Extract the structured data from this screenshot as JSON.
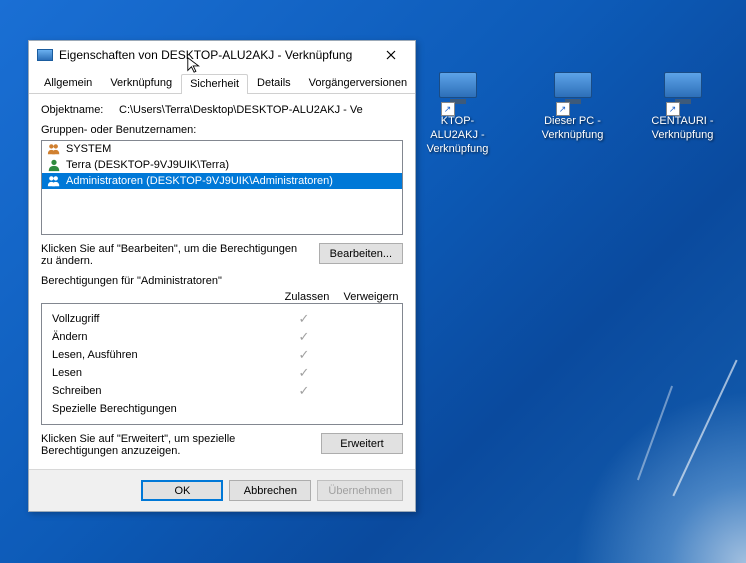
{
  "desktop_icons": [
    {
      "label_l1": "KTOP-ALU2AKJ -",
      "label_l2": "Verknüpfung"
    },
    {
      "label_l1": "Dieser PC -",
      "label_l2": "Verknüpfung"
    },
    {
      "label_l1": "CENTAURI -",
      "label_l2": "Verknüpfung"
    }
  ],
  "dialog": {
    "title": "Eigenschaften von DESKTOP-ALU2AKJ - Verknüpfung",
    "tabs": {
      "general": "Allgemein",
      "shortcut": "Verknüpfung",
      "security": "Sicherheit",
      "details": "Details",
      "previous": "Vorgängerversionen"
    },
    "objectname_label": "Objektname:",
    "objectname_value": "C:\\Users\\Terra\\Desktop\\DESKTOP-ALU2AKJ - Ve",
    "groups_label": "Gruppen- oder Benutzernamen:",
    "users": [
      {
        "name": "SYSTEM",
        "type": "group"
      },
      {
        "name": "Terra (DESKTOP-9VJ9UIK\\Terra)",
        "type": "user"
      },
      {
        "name": "Administratoren (DESKTOP-9VJ9UIK\\Administratoren)",
        "type": "group",
        "selected": true
      }
    ],
    "edit_hint": "Klicken Sie auf \"Bearbeiten\", um die Berechtigungen zu ändern.",
    "edit_btn": "Bearbeiten...",
    "perms_for": "Berechtigungen für \"Administratoren\"",
    "allow": "Zulassen",
    "deny": "Verweigern",
    "perms": [
      {
        "name": "Vollzugriff",
        "allow": true,
        "deny": false
      },
      {
        "name": "Ändern",
        "allow": true,
        "deny": false
      },
      {
        "name": "Lesen, Ausführen",
        "allow": true,
        "deny": false
      },
      {
        "name": "Lesen",
        "allow": true,
        "deny": false
      },
      {
        "name": "Schreiben",
        "allow": true,
        "deny": false
      },
      {
        "name": "Spezielle Berechtigungen",
        "allow": false,
        "deny": false
      }
    ],
    "advanced_hint": "Klicken Sie auf \"Erweitert\", um spezielle Berechtigungen anzuzeigen.",
    "advanced_btn": "Erweitert",
    "ok": "OK",
    "cancel": "Abbrechen",
    "apply": "Übernehmen"
  }
}
